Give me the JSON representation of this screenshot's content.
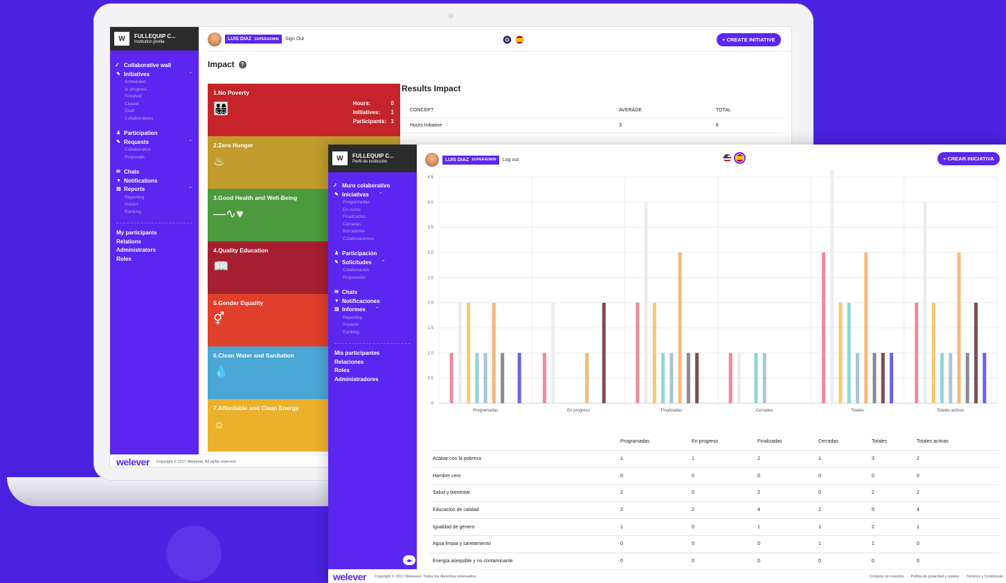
{
  "colors": {
    "brand": "#5a26f0",
    "background": "#4a22e0",
    "sidebar_head": "#2b2b2b"
  },
  "laptop": {
    "org": {
      "name": "FULLEQUIP C...",
      "subtitle": "Institution profile",
      "logo_text": "W"
    },
    "user": {
      "name": "LUIS DIAZ",
      "role": "SUPERADMIN",
      "signout": "Sign Out"
    },
    "cta": "+ CREATE INITIATIVE",
    "page_title": "Impact",
    "help_icon": "?",
    "sidebar": {
      "collab": "Collaborative wall",
      "initiatives": "Initiatives",
      "initiatives_sub": [
        "Scheduled",
        "In progress",
        "Finished",
        "Closed",
        "Draft",
        "Collaborations"
      ],
      "participation": "Participation",
      "requests": "Requests",
      "requests_sub": [
        "Collaboration",
        "Proposals"
      ],
      "chats": "Chats",
      "notifications": "Notifications",
      "reports": "Reports",
      "reports_sub": [
        "Reporting",
        "Impact",
        "Ranking"
      ],
      "bottom": [
        "My participants",
        "Relations",
        "Administrators",
        "Roles"
      ]
    },
    "goals": [
      {
        "title": "1.No Poverty",
        "icon": "👨‍👩‍👧‍👦",
        "icon_name": "family-icon",
        "color": "#c6232a",
        "stats": [
          {
            "label": "Hours:",
            "value": "0"
          },
          {
            "label": "Initiatives:",
            "value": "1"
          },
          {
            "label": "Participants:",
            "value": "1"
          }
        ]
      },
      {
        "title": "2.Zero Hunger",
        "icon": "♨",
        "icon_name": "bowl-icon",
        "color": "#c19c2c",
        "stats": []
      },
      {
        "title": "3.Good Health and Well-Being",
        "icon": "—∿♥",
        "icon_name": "heartbeat-icon",
        "color": "#4b9a3c",
        "stats": []
      },
      {
        "title": "4.Quality Education",
        "icon": "📖",
        "icon_name": "book-icon",
        "color": "#a61f30",
        "stats": []
      },
      {
        "title": "5.Gender Equality",
        "icon": "⚥",
        "icon_name": "gender-icon",
        "color": "#e03f2c",
        "stats": []
      },
      {
        "title": "6.Clean Water and Sanitation",
        "icon": "💧",
        "icon_name": "water-icon",
        "color": "#4aa6d3",
        "stats": []
      },
      {
        "title": "7.Affordable and Clean Energy",
        "icon": "☼",
        "icon_name": "sun-icon",
        "color": "#ecb12a",
        "stats": []
      }
    ],
    "results": {
      "title": "Results Impact",
      "headers": [
        "CONCEPT",
        "AVERAGE",
        "TOTAL"
      ],
      "rows": [
        [
          "Hours Initiative",
          "3",
          "6"
        ]
      ]
    },
    "footer": {
      "brand": "welever",
      "copyright": "Copyright © 2017 Weleever. All rights reserved."
    }
  },
  "window2": {
    "org": {
      "name": "FULLEQUIP C...",
      "subtitle": "Perfil de institución",
      "logo_text": "W"
    },
    "user": {
      "name": "LUIS DIAZ",
      "role": "SUPERADMIN",
      "signout": "Log out"
    },
    "cta": "+ CREAR INICIATIVA",
    "toggle": "◂▸",
    "sidebar": {
      "collab": "Muro colaborativo",
      "initiatives": "Iniciativas",
      "initiatives_sub": [
        "Programadas",
        "En curso",
        "Finalizadas",
        "Cerradas",
        "Borradores",
        "Colaboraciones"
      ],
      "participation": "Participación",
      "requests": "Solicitudes",
      "requests_sub": [
        "Colaboración",
        "Propuestas"
      ],
      "chats": "Chats",
      "notifications": "Notificaciones",
      "reports": "Informes",
      "reports_sub": [
        "Reporting",
        "Impacto",
        "Ranking"
      ],
      "bottom": [
        "Mis participantes",
        "Relaciones",
        "Roles",
        "Administradores"
      ]
    },
    "table": {
      "headers": [
        "",
        "Programadas",
        "En progreso",
        "Finalizadas",
        "Cerradas",
        "Totales",
        "Totales activas"
      ],
      "rows": [
        [
          "Acabar con la pobreza",
          "1",
          "1",
          "2",
          "1",
          "3",
          "2"
        ],
        [
          "Hambre cero",
          "0",
          "0",
          "0",
          "0",
          "0",
          "0"
        ],
        [
          "Salud y bienestar",
          "2",
          "0",
          "2",
          "0",
          "2",
          "2"
        ],
        [
          "Educación de calidad",
          "2",
          "2",
          "4",
          "1",
          "5",
          "4"
        ],
        [
          "Igualdad de género",
          "1",
          "0",
          "1",
          "1",
          "2",
          "1"
        ],
        [
          "Agua limpia y saneamiento",
          "0",
          "0",
          "0",
          "1",
          "1",
          "0"
        ],
        [
          "Energía asequible y no contaminante",
          "0",
          "0",
          "0",
          "0",
          "0",
          "0"
        ]
      ]
    },
    "footer": {
      "brand": "welever",
      "copyright": "Copyright © 2017 Weleever. Todos los derechos reservados.",
      "links": [
        "Contacta con nosotros",
        "Política de privacidad y cookies",
        "Términos y Condiciones"
      ]
    }
  },
  "chart_data": {
    "type": "bar",
    "categories": [
      "Programadas",
      "En progreso",
      "Finalizadas",
      "Cerradas",
      "Totales",
      "Totales activas"
    ],
    "yticks": [
      "0",
      "0.5",
      "1.0",
      "1.5",
      "2.0",
      "2.5",
      "3.0",
      "3.5",
      "4.0",
      "4.5"
    ],
    "ylim": [
      0,
      4.5
    ],
    "grid": true,
    "colors": [
      "#f08a9a",
      "#eceded",
      "#f7c86f",
      "#8fd6d6",
      "#a9c6d6",
      "#f6b97a",
      "#8a8a93",
      "#7b4e4e",
      "#6b63e8"
    ],
    "series": [
      {
        "values": [
          1,
          1,
          2,
          1,
          3,
          2
        ]
      },
      {
        "values": [
          2,
          2,
          4,
          1,
          5,
          4
        ]
      },
      {
        "values": [
          2,
          0,
          2,
          0,
          2,
          2
        ]
      },
      {
        "values": [
          1,
          0,
          1,
          1,
          2,
          1
        ]
      },
      {
        "values": [
          1,
          0,
          1,
          1,
          1,
          1
        ]
      },
      {
        "values": [
          2,
          1,
          3,
          0,
          3,
          3
        ]
      },
      {
        "values": [
          1,
          0,
          1,
          0,
          1,
          1
        ]
      },
      {
        "values": [
          0,
          2,
          1,
          0,
          1,
          2
        ]
      },
      {
        "values": [
          1,
          0,
          0,
          0,
          1,
          1
        ]
      }
    ]
  }
}
